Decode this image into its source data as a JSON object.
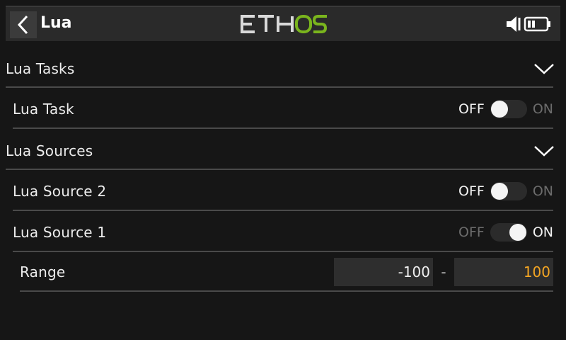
{
  "header": {
    "title": "Lua",
    "logo_text": "ETHOS",
    "back_icon": "chevron-left-icon",
    "speaker_icon": "speaker-icon",
    "battery_icon": "battery-icon",
    "logo_colors": {
      "eth": "#d9d9d9",
      "os": "#7ab51d"
    }
  },
  "sections": {
    "lua_tasks": {
      "label": "Lua Tasks",
      "expanded": true
    },
    "lua_sources": {
      "label": "Lua Sources",
      "expanded": true
    }
  },
  "items": {
    "lua_task": {
      "label": "Lua Task",
      "off_label": "OFF",
      "on_label": "ON",
      "state": "OFF"
    },
    "lua_source_2": {
      "label": "Lua Source 2",
      "off_label": "OFF",
      "on_label": "ON",
      "state": "OFF"
    },
    "lua_source_1": {
      "label": "Lua Source 1",
      "off_label": "OFF",
      "on_label": "ON",
      "state": "ON"
    }
  },
  "range": {
    "label": "Range",
    "min": "-100",
    "separator": "-",
    "max": "100",
    "max_color": "#f5a623"
  }
}
